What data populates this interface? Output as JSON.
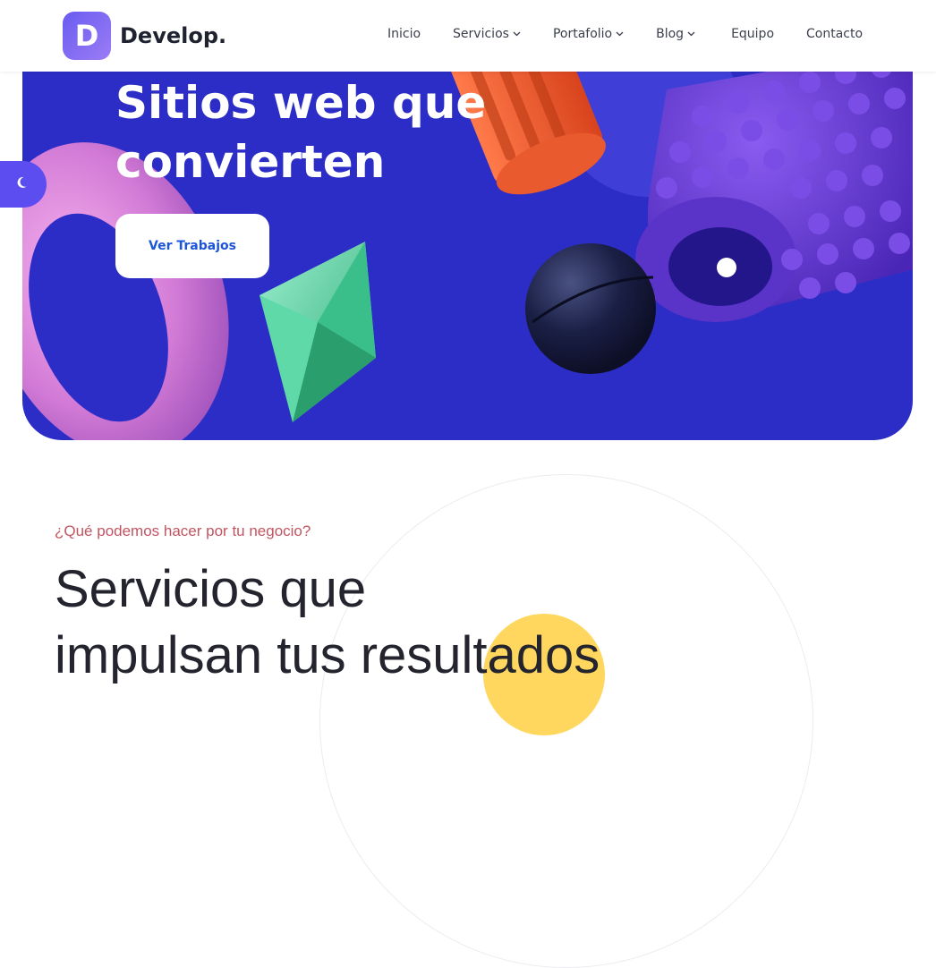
{
  "brand": {
    "initial": "D",
    "name": "Develop."
  },
  "nav": {
    "items": [
      {
        "label": "Inicio",
        "dropdown": false
      },
      {
        "label": "Servicios",
        "dropdown": true
      },
      {
        "label": "Portafolio",
        "dropdown": true
      },
      {
        "label": "Blog",
        "dropdown": true
      },
      {
        "label": "Equipo",
        "dropdown": false
      },
      {
        "label": "Contacto",
        "dropdown": false
      }
    ]
  },
  "hero": {
    "title_line1": "Sitios web que",
    "title_line2": "convierten",
    "cta_label": "Ver Trabajos",
    "background": "#2b2dc6"
  },
  "theme_toggle": {
    "icon": "moon-icon"
  },
  "services": {
    "eyebrow": "¿Qué podemos hacer por tu negocio?",
    "title_line1": "Servicios que",
    "title_line2": "impulsan tus resultados"
  },
  "colors": {
    "accent": "#5b4df0",
    "eyebrow": "#c25561",
    "highlight": "#ffd75e"
  }
}
